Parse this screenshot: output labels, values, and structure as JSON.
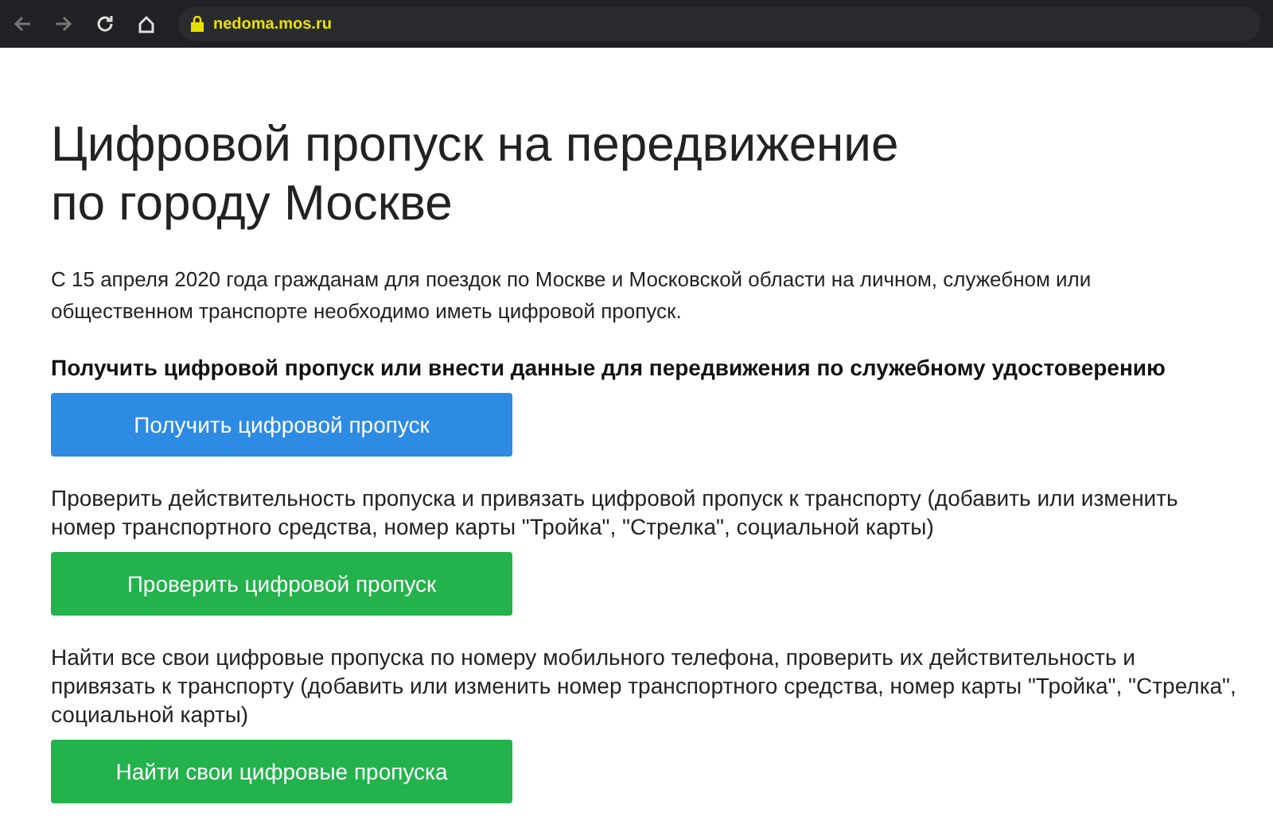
{
  "browser": {
    "url": "nedoma.mos.ru"
  },
  "title": "Цифровой пропуск на передвижение по городу Москве",
  "intro": "С 15 апреля 2020 года гражданам для поездок по Москве и Московской области на личном, служебном или общественном транспорте необходимо иметь цифровой пропуск.",
  "sections": [
    {
      "text": "Получить цифровой пропуск или внести данные для передвижения по служебному удостоверению",
      "bold": true,
      "button": "Получить цифровой пропуск",
      "color": "#2e8be3"
    },
    {
      "text": "Проверить действительность пропуска и привязать цифровой пропуск к транспорту (добавить или изменить номер транспортного средства, номер карты \"Тройка\", \"Стрелка\", социальной карты)",
      "bold": false,
      "button": "Проверить цифровой пропуск",
      "color": "#23b24c"
    },
    {
      "text": "Найти все свои цифровые пропуска по номеру мобильного телефона, проверить их действительность и привязать к транспорту (добавить или изменить номер транспортного средства, номер карты \"Тройка\", \"Стрелка\", социальной карты)",
      "bold": false,
      "button": "Найти свои цифровые пропуска",
      "color": "#23b24c"
    }
  ]
}
